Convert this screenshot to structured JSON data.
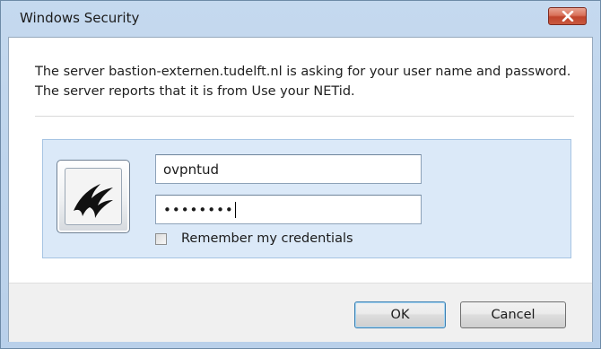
{
  "window": {
    "title": "Windows Security",
    "close_icon": "close-x-icon"
  },
  "message": "The server bastion-externen.tudelft.nl is asking for your user name and password. The server reports that it is from Use your NETid.",
  "credentials": {
    "tile_icon": "user-account-picture-icon",
    "username_value": "ovpntud",
    "password_masked": "••••••••",
    "remember_label": "Remember my credentials",
    "remember_checked": false
  },
  "buttons": {
    "ok_label": "OK",
    "cancel_label": "Cancel"
  }
}
